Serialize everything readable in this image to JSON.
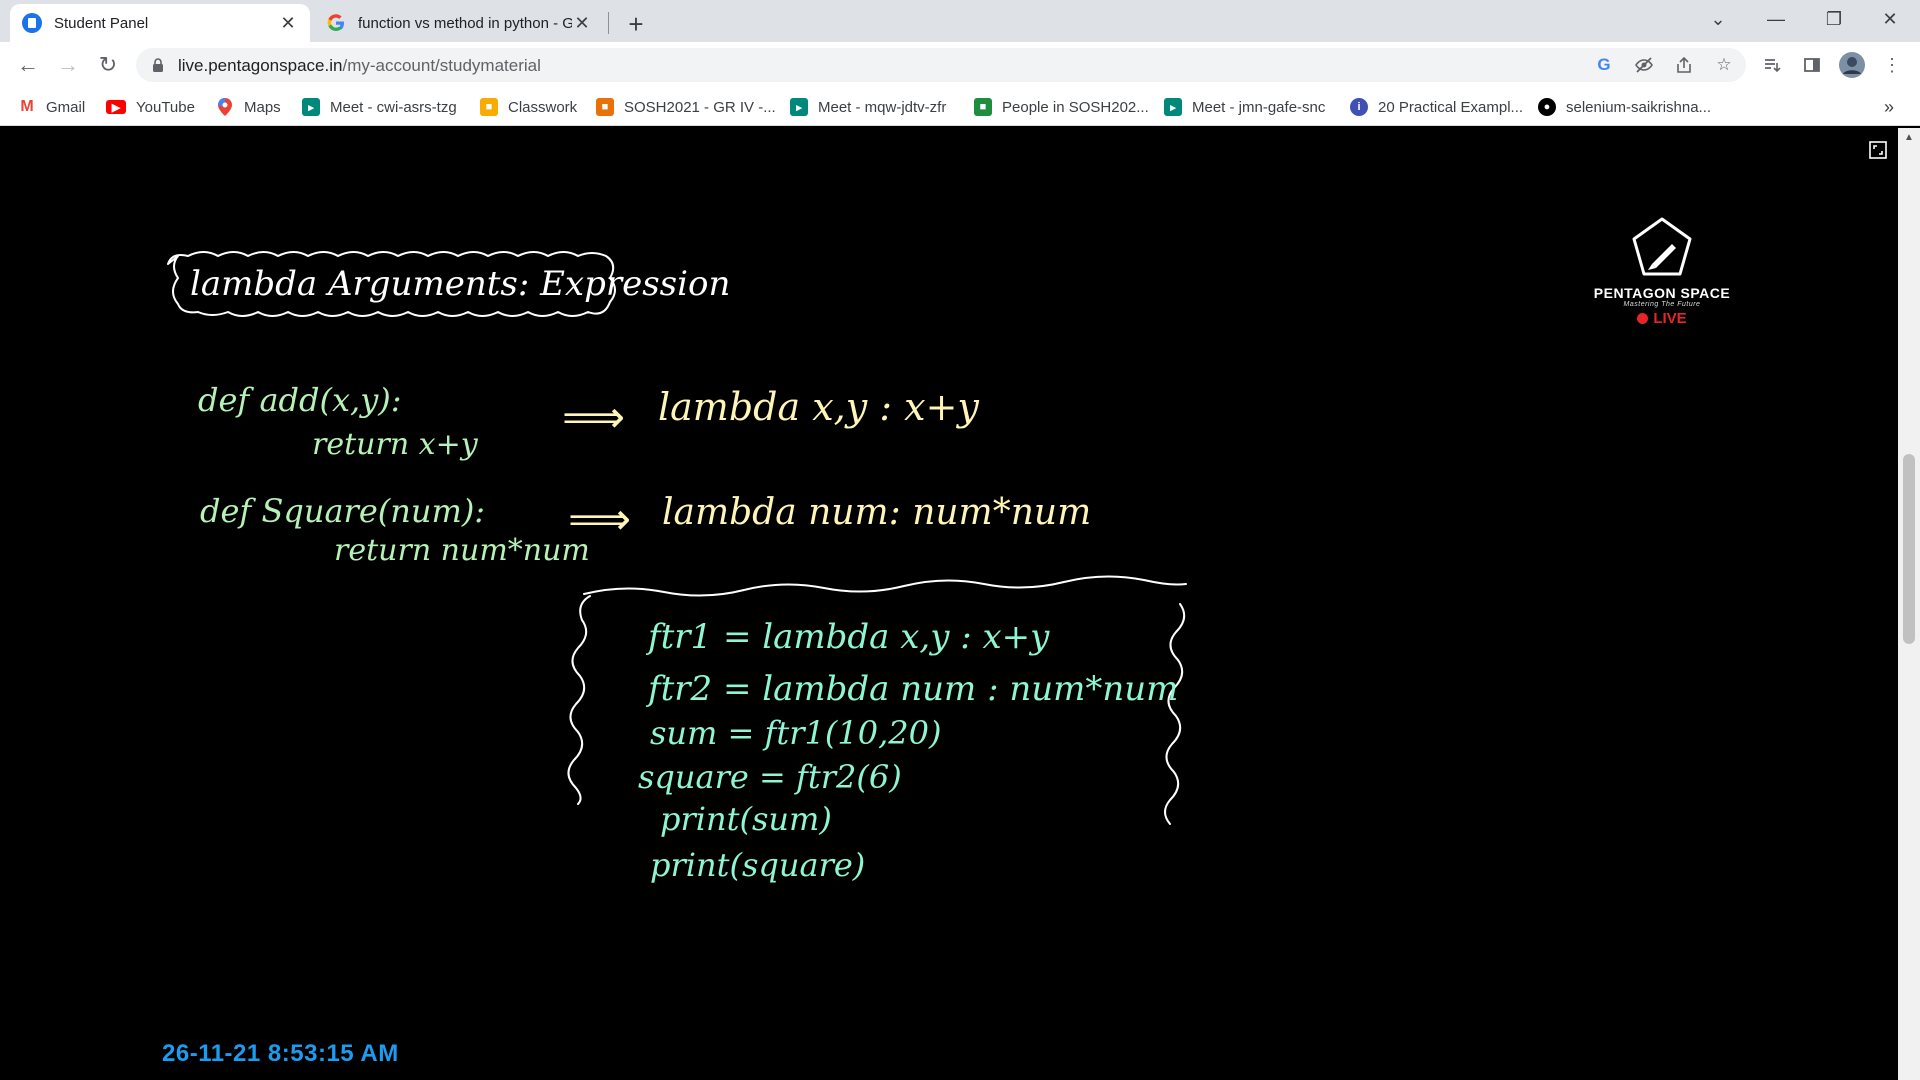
{
  "browser": {
    "tabs": [
      {
        "title": "Student Panel",
        "favicon": "pentagon-favicon",
        "active": true
      },
      {
        "title": "function vs method in python - G",
        "favicon": "google-favicon",
        "active": false
      }
    ],
    "new_tab_label": "+",
    "window_controls": {
      "tab_search": "⌄",
      "minimize": "—",
      "restore": "❐",
      "close": "✕"
    },
    "nav": {
      "back": "←",
      "forward": "→",
      "reload": "↻"
    },
    "url": {
      "host": "live.pentagonspace.in",
      "path": "/my-account/studymaterial"
    },
    "omnibox_icons": [
      "google-lens-icon",
      "eye-off-icon",
      "share-icon",
      "star-icon"
    ],
    "toolbar_icons": [
      "reading-list-icon",
      "side-panel-icon",
      "profile-avatar",
      "kebab-menu-icon"
    ]
  },
  "bookmarks": [
    {
      "label": "Gmail",
      "icon": "gmail-icon",
      "color": "#ea4335"
    },
    {
      "label": "YouTube",
      "icon": "youtube-icon",
      "color": "#ff0000"
    },
    {
      "label": "Maps",
      "icon": "maps-icon",
      "color": "#34a853"
    },
    {
      "label": "Meet - cwi-asrs-tzg",
      "icon": "meet-icon",
      "color": "#00897b"
    },
    {
      "label": "Classwork",
      "icon": "classroom-icon",
      "color": "#f9ab00"
    },
    {
      "label": "SOSH2021 - GR IV -...",
      "icon": "classroom-icon",
      "color": "#e8710a"
    },
    {
      "label": "Meet - mqw-jdtv-zfr",
      "icon": "meet-icon",
      "color": "#00897b"
    },
    {
      "label": "People in SOSH202...",
      "icon": "classroom-icon",
      "color": "#1e8e3e"
    },
    {
      "label": "Meet - jmn-gafe-snc",
      "icon": "meet-icon",
      "color": "#00897b"
    },
    {
      "label": "20 Practical Exampl...",
      "icon": "site-icon",
      "color": "#3f51b5"
    },
    {
      "label": "selenium-saikrishna...",
      "icon": "github-icon",
      "color": "#000000"
    }
  ],
  "bookmarks_overflow": "»",
  "video": {
    "heading": "lambda Arguments: Expression",
    "left_code": [
      "def add(x,y):",
      "return x+y",
      "def Square(num):",
      "return num*num"
    ],
    "arrows": [
      "⟹",
      "⟹"
    ],
    "lambdas": [
      "lambda x,y : x+y",
      "lambda num: num*num"
    ],
    "box_code": [
      "ftr1 = lambda x,y : x+y",
      "ftr2 = lambda num : num*num",
      "sum = ftr1(10,20)",
      "square = ftr2(6)",
      "print(sum)",
      "print(square)"
    ],
    "logo": {
      "brand": "PENTAGON SPACE",
      "tagline": "Mastering The Future",
      "live": "LIVE"
    },
    "timestamp": "26-11-21 8:53:15 AM",
    "colors": {
      "heading": "#ffffff",
      "left_code": "#b6f2b6",
      "lambda": "#fff5b8",
      "box_code": "#8ff5d4",
      "box_border": "#ffffff",
      "timestamp": "#1d9bf0",
      "live": "#e8242b"
    }
  }
}
